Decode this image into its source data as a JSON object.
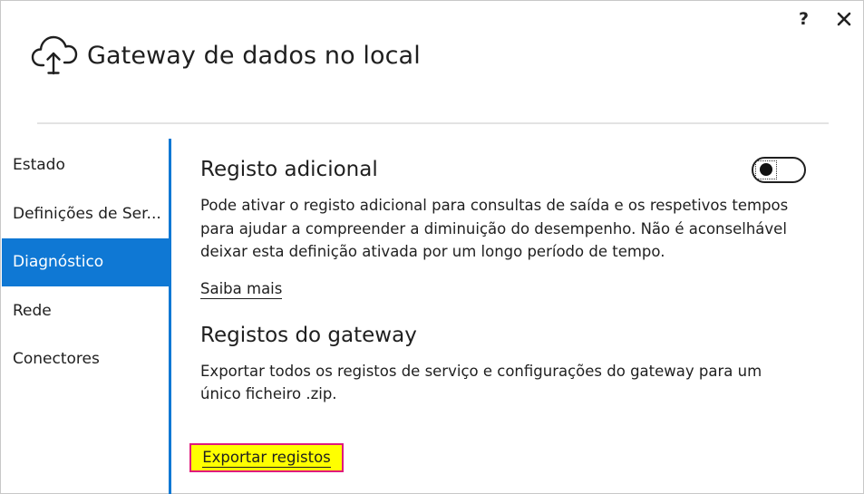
{
  "window": {
    "help_label": "?",
    "close_icon": "close-icon"
  },
  "header": {
    "icon": "cloud-upload-icon",
    "title": "Gateway de dados no local"
  },
  "sidebar": {
    "items": [
      {
        "label": "Estado",
        "active": false
      },
      {
        "label": "Definições de Ser...",
        "active": false
      },
      {
        "label": "Diagnóstico",
        "active": true
      },
      {
        "label": "Rede",
        "active": false
      },
      {
        "label": "Conectores",
        "active": false
      }
    ]
  },
  "main": {
    "additional_logging": {
      "title": "Registo adicional",
      "toggle_on": false,
      "description": "Pode ativar o registo adicional para consultas de saída e os respetivos tempos para ajudar a compreender a diminuição do desempenho. Não é aconselhável deixar esta definição ativada por um longo período de tempo.",
      "learn_more": "Saiba mais"
    },
    "gateway_logs": {
      "title": "Registos do gateway",
      "description": "Exportar todos os registos de serviço e configurações do gateway para um único ficheiro .zip.",
      "export_label": "Exportar registos"
    }
  },
  "colors": {
    "accent": "#0f78d4",
    "highlight": "#ffff00",
    "highlight_border": "#e0197d"
  }
}
